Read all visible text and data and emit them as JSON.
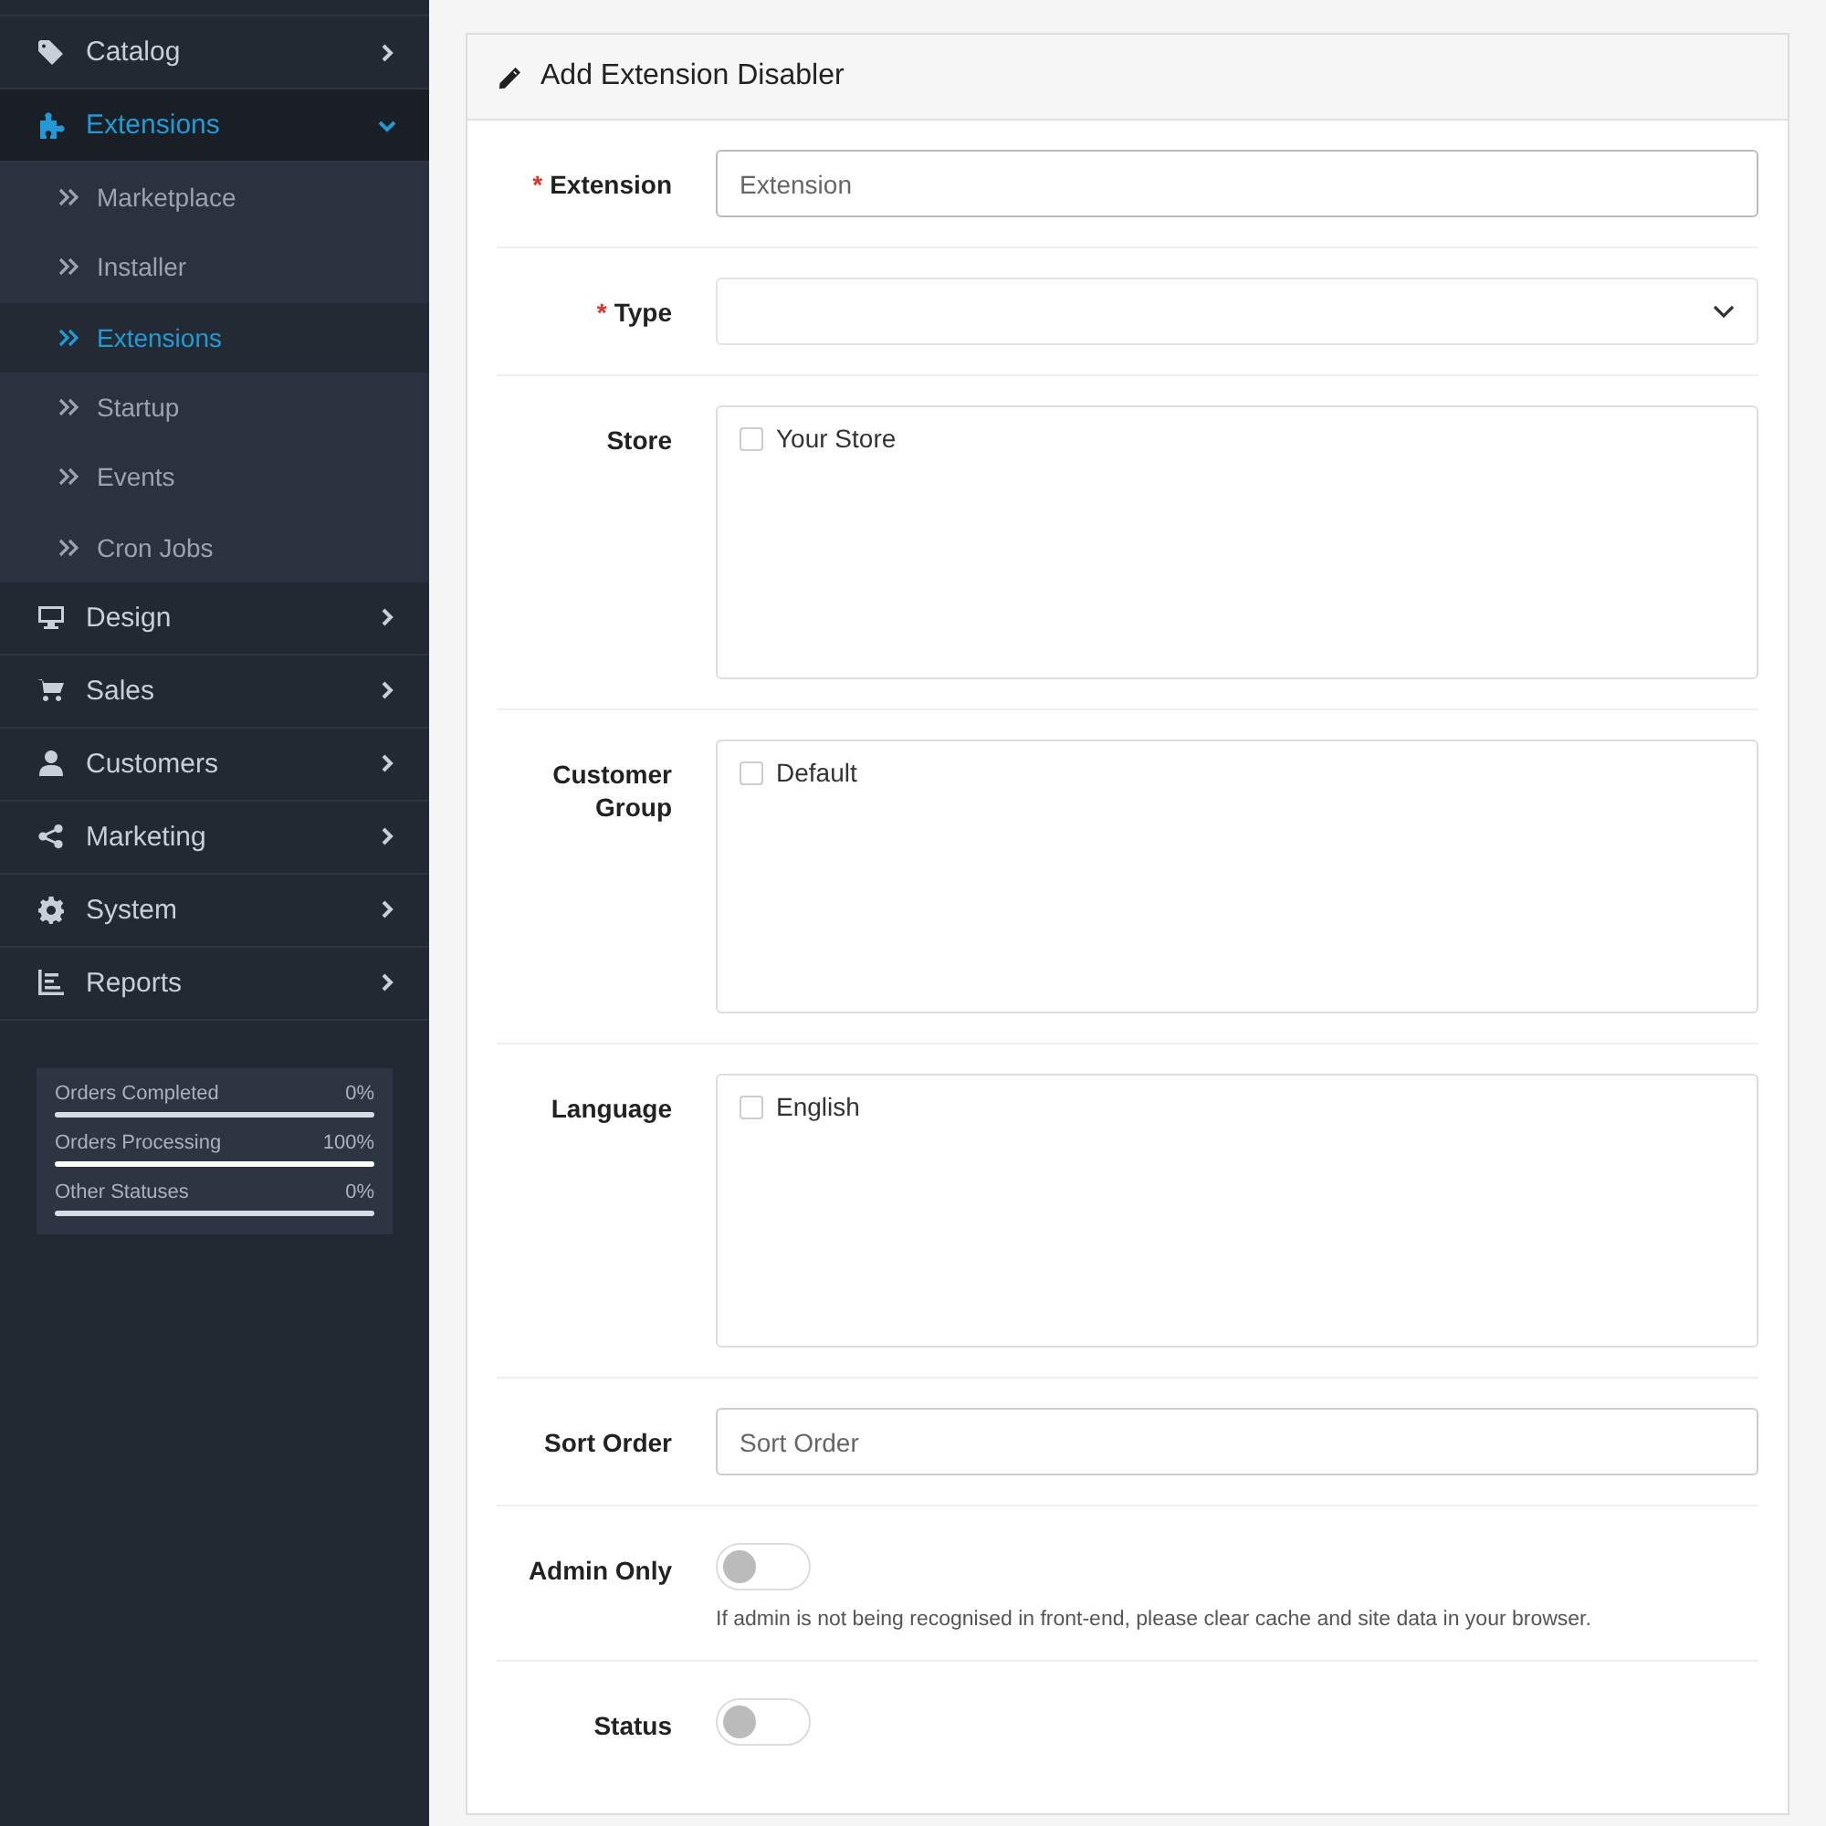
{
  "sidebar": {
    "items": [
      {
        "label": "Catalog",
        "expanded": false,
        "selected": false
      },
      {
        "label": "Extensions",
        "expanded": true,
        "selected": true,
        "children": [
          {
            "label": "Marketplace",
            "selected": false
          },
          {
            "label": "Installer",
            "selected": false
          },
          {
            "label": "Extensions",
            "selected": true
          },
          {
            "label": "Startup",
            "selected": false
          },
          {
            "label": "Events",
            "selected": false
          },
          {
            "label": "Cron Jobs",
            "selected": false
          }
        ]
      },
      {
        "label": "Design",
        "expanded": false,
        "selected": false
      },
      {
        "label": "Sales",
        "expanded": false,
        "selected": false
      },
      {
        "label": "Customers",
        "expanded": false,
        "selected": false
      },
      {
        "label": "Marketing",
        "expanded": false,
        "selected": false
      },
      {
        "label": "System",
        "expanded": false,
        "selected": false
      },
      {
        "label": "Reports",
        "expanded": false,
        "selected": false
      }
    ],
    "stats": [
      {
        "label": "Orders Completed",
        "reading": "0%",
        "level": 0
      },
      {
        "label": "Orders Processing",
        "reading": "100%",
        "level": 1
      },
      {
        "label": "Other Statuses",
        "reading": "0%",
        "level": 0
      }
    ]
  },
  "card": {
    "title": "Add Extension Disabler",
    "fields": [
      {
        "label": "Extension",
        "kind": "text",
        "mark": "*",
        "placeholder": "Extension"
      },
      {
        "label": "Type",
        "kind": "select",
        "mark": "*"
      },
      {
        "label": "Store",
        "kind": "checklist",
        "options": [
          {
            "label": "Your Store",
            "checked": false
          }
        ]
      },
      {
        "label": "Customer Group",
        "kind": "checklist",
        "options": [
          {
            "label": "Default",
            "checked": false
          }
        ]
      },
      {
        "label": "Language",
        "kind": "checklist",
        "options": [
          {
            "label": "English",
            "checked": false
          }
        ]
      },
      {
        "label": "Sort Order",
        "kind": "text",
        "placeholder": "Sort Order"
      },
      {
        "label": "Admin Only",
        "kind": "toggle",
        "on": false,
        "help": "If admin is not being recognised in front-end, please clear cache and site data in your browser."
      },
      {
        "label": "Status",
        "kind": "toggle",
        "on": false
      }
    ]
  }
}
